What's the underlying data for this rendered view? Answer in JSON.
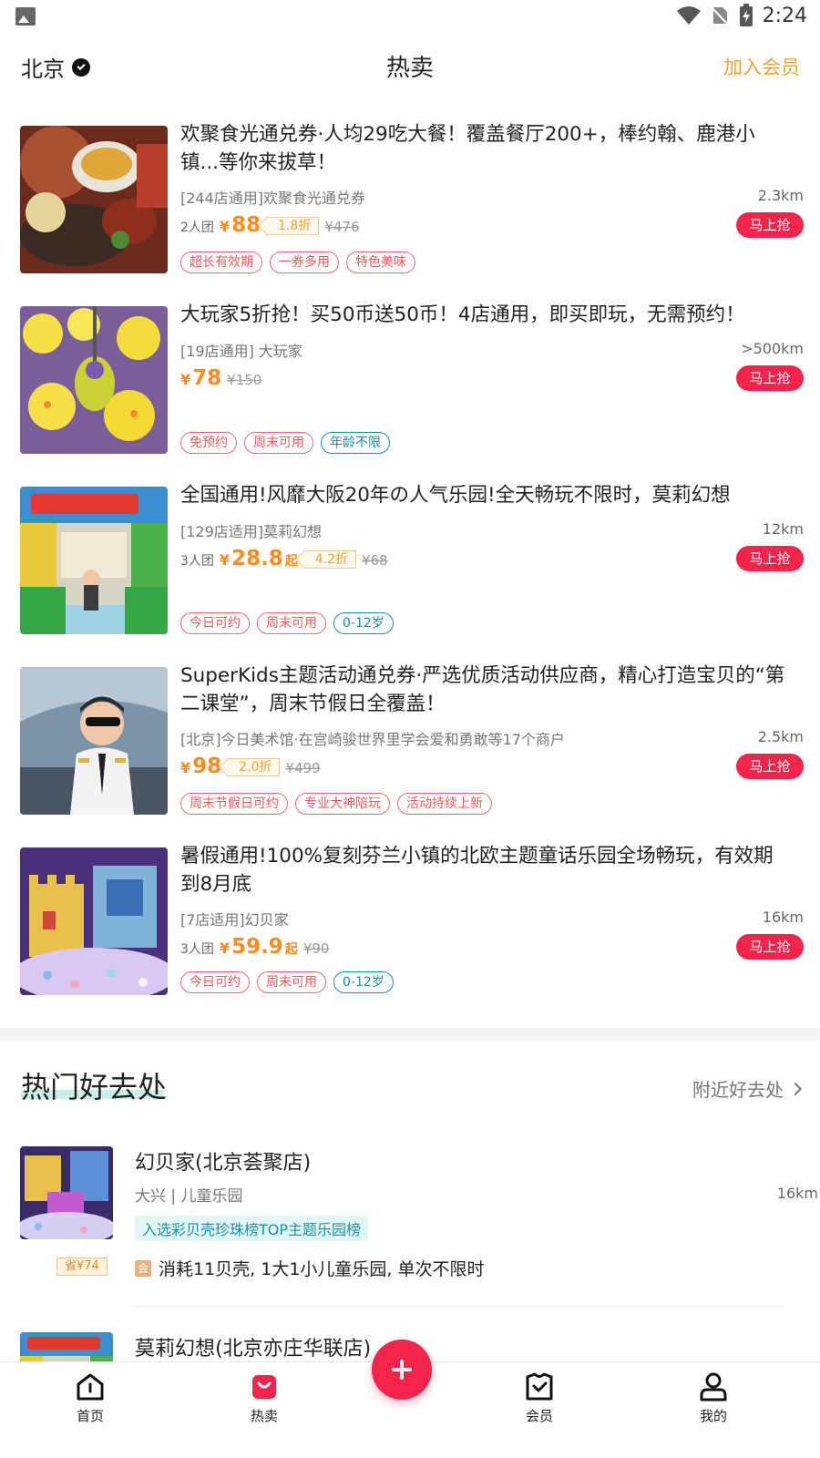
{
  "status_bar": {
    "time": "2:24"
  },
  "header": {
    "city": "北京",
    "title": "热卖",
    "join_member": "加入会员"
  },
  "deals": [
    {
      "title": "欢聚食光通兑券·人均29吃大餐！覆盖餐厅200+，棒约翰、鹿港小镇...等你来拔草！",
      "subtitle": "[244店通用]欢聚食光通兑券",
      "distance": "2.3km",
      "group": "2人团",
      "currency": "¥",
      "price": "88",
      "suffix": "",
      "discount": "1.8折",
      "old_price": "¥476",
      "buy": "马上抢",
      "tags": [
        {
          "text": "超长有效期",
          "style": "red"
        },
        {
          "text": "一券多用",
          "style": "red"
        },
        {
          "text": "特色美味",
          "style": "red"
        }
      ]
    },
    {
      "title": "大玩家5折抢！买50币送50币！4店通用，即买即玩，无需预约！",
      "subtitle": "[19店通用] 大玩家",
      "distance": ">500km",
      "group": "",
      "currency": "¥",
      "price": "78",
      "suffix": "",
      "discount": "",
      "old_price": "¥150",
      "buy": "马上抢",
      "tags": [
        {
          "text": "免预约",
          "style": "red"
        },
        {
          "text": "周末可用",
          "style": "red"
        },
        {
          "text": "年龄不限",
          "style": "teal"
        }
      ]
    },
    {
      "title": "全国通用!风靡大阪20年の人气乐园!全天畅玩不限时，莫莉幻想",
      "subtitle": "[129店适用]莫莉幻想",
      "distance": "12km",
      "group": "3人团",
      "currency": "¥",
      "price": "28.8",
      "suffix": "起",
      "discount": "4.2折",
      "old_price": "¥68",
      "buy": "马上抢",
      "tags": [
        {
          "text": "今日可约",
          "style": "red"
        },
        {
          "text": "周末可用",
          "style": "red"
        },
        {
          "text": "0-12岁",
          "style": "teal"
        }
      ]
    },
    {
      "title": "SuperKids主题活动通兑券·严选优质活动供应商，精心打造宝贝的“第二课堂”，周末节假日全覆盖！",
      "subtitle": "[北京]今日美术馆·在宫崎骏世界里学会爱和勇敢等17个商户",
      "distance": "2.5km",
      "group": "",
      "currency": "¥",
      "price": "98",
      "suffix": "",
      "discount": "2.0折",
      "old_price": "¥499",
      "buy": "马上抢",
      "tags": [
        {
          "text": "周末节假日可约",
          "style": "red"
        },
        {
          "text": "专业大神陪玩",
          "style": "red"
        },
        {
          "text": "活动持续上新",
          "style": "red"
        }
      ]
    },
    {
      "title": "暑假通用!100%复刻芬兰小镇的北欧主题童话乐园全场畅玩，有效期到8月底",
      "subtitle": "[7店适用]幻贝家",
      "distance": "16km",
      "group": "3人团",
      "currency": "¥",
      "price": "59.9",
      "suffix": "起",
      "discount": "",
      "old_price": "¥90",
      "buy": "马上抢",
      "tags": [
        {
          "text": "今日可约",
          "style": "red"
        },
        {
          "text": "周末可用",
          "style": "red"
        },
        {
          "text": "0-12岁",
          "style": "teal"
        }
      ]
    }
  ],
  "hot_places": {
    "title": "热门好去处",
    "more": "附近好去处",
    "items": [
      {
        "name": "幻贝家(北京荟聚店)",
        "meta": "大兴 | 儿童乐园",
        "distance": "16km",
        "rank": "入选彩贝壳珍珠榜TOP主题乐园榜",
        "save": "省¥74",
        "member_icon": "会",
        "member_text": "消耗11贝壳, 1大1小儿童乐园, 单次不限时"
      },
      {
        "name": "莫莉幻想(北京亦庄华联店)"
      }
    ]
  },
  "bottom_nav": [
    {
      "label": "首页",
      "icon": "home-icon"
    },
    {
      "label": "热卖",
      "icon": "hot-sale-icon"
    },
    {
      "label": "会员",
      "icon": "member-icon"
    },
    {
      "label": "我的",
      "icon": "profile-icon"
    }
  ],
  "colors": {
    "accent_red": "#f3244b",
    "price_orange": "#ff8a1e",
    "member_gold": "#f0a236",
    "teal": "#1a93a3"
  }
}
